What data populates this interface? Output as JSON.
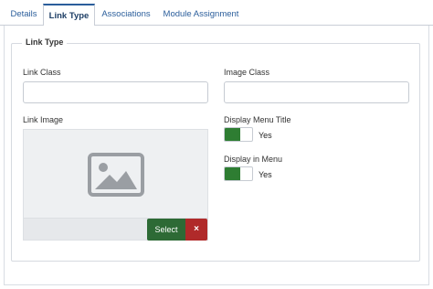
{
  "tabs": [
    {
      "label": "Details",
      "active": false
    },
    {
      "label": "Link Type",
      "active": true
    },
    {
      "label": "Associations",
      "active": false
    },
    {
      "label": "Module Assignment",
      "active": false
    }
  ],
  "fieldset": {
    "legend": "Link Type"
  },
  "fields": {
    "link_class": {
      "label": "Link Class",
      "value": ""
    },
    "image_class": {
      "label": "Image Class",
      "value": ""
    },
    "link_image": {
      "label": "Link Image",
      "select_label": "Select",
      "clear_label": "×",
      "placeholder_icon": "image-placeholder-icon"
    },
    "display_menu_title": {
      "label": "Display Menu Title",
      "value": "Yes",
      "on": true
    },
    "display_in_menu": {
      "label": "Display in Menu",
      "value": "Yes",
      "on": true
    }
  },
  "colors": {
    "accent": "#2b5e9b",
    "toggle_on": "#2e7d32",
    "select_btn": "#2d6a35",
    "clear_btn": "#b02a2a"
  }
}
